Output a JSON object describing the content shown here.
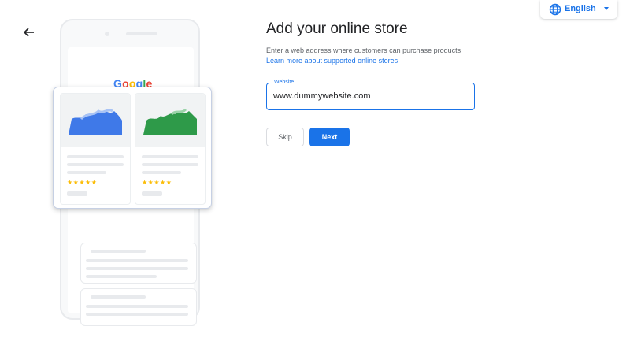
{
  "language": {
    "label": "English",
    "icon": "globe-icon"
  },
  "nav": {
    "back_icon": "arrow-left-icon"
  },
  "illustration": {
    "logo_letters": [
      "G",
      "o",
      "o",
      "g",
      "l",
      "e"
    ],
    "rating": "★★★★★",
    "colors": {
      "blue_chart": "#3f79e8",
      "green_chart": "#2e9a49",
      "star": "#fbbc05"
    }
  },
  "page": {
    "title": "Add your online store",
    "description": "Enter a web address where customers can purchase products",
    "learn_more": "Learn more about supported online stores"
  },
  "website_field": {
    "label": "Website",
    "value": "www.dummywebsite.com"
  },
  "buttons": {
    "skip": "Skip",
    "next": "Next"
  },
  "colors": {
    "accent": "#1a73e8",
    "text": "#202124",
    "secondary_text": "#5f6368"
  }
}
